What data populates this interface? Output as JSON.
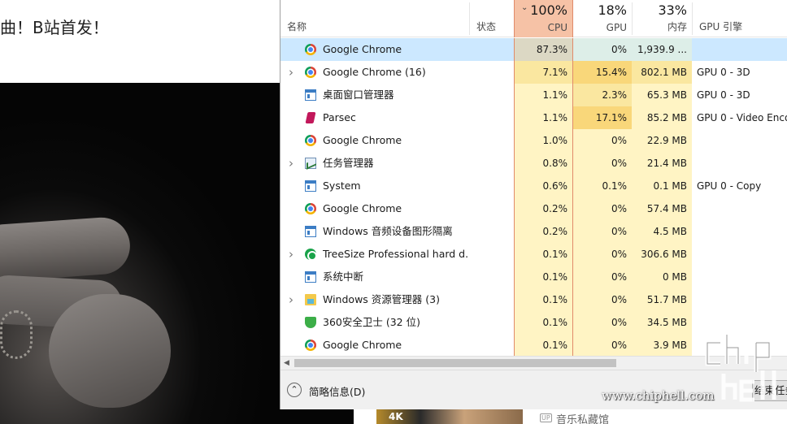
{
  "background_page": {
    "title": "曲！B站首发！",
    "thumb_badge": "4K",
    "up_badge": "UP",
    "up_name": "音乐私藏馆"
  },
  "task_manager": {
    "columns": {
      "name": "名称",
      "status": "状态",
      "cpu": {
        "pct": "100%",
        "label": "CPU"
      },
      "gpu": {
        "pct": "18%",
        "label": "GPU"
      },
      "memory": {
        "pct": "33%",
        "label": "内存"
      },
      "gpu_engine": "GPU 引擎"
    },
    "rows": [
      {
        "name": "Google Chrome",
        "icon": "chrome-icon",
        "expandable": false,
        "cpu": "87.3%",
        "gpu": "0%",
        "mem": "1,939.9 ...",
        "engine": "",
        "selected": true
      },
      {
        "name": "Google Chrome (16)",
        "icon": "chrome-icon",
        "expandable": true,
        "cpu": "7.1%",
        "gpu": "15.4%",
        "mem": "802.1 MB",
        "engine": "GPU 0 - 3D",
        "selected": false
      },
      {
        "name": "桌面窗口管理器",
        "icon": "window-icon",
        "expandable": false,
        "cpu": "1.1%",
        "gpu": "2.3%",
        "mem": "65.3 MB",
        "engine": "GPU 0 - 3D",
        "selected": false
      },
      {
        "name": "Parsec",
        "icon": "parsec-icon",
        "expandable": false,
        "cpu": "1.1%",
        "gpu": "17.1%",
        "mem": "85.2 MB",
        "engine": "GPU 0 - Video Enco",
        "selected": false
      },
      {
        "name": "Google Chrome",
        "icon": "chrome-icon",
        "expandable": false,
        "cpu": "1.0%",
        "gpu": "0%",
        "mem": "22.9 MB",
        "engine": "",
        "selected": false
      },
      {
        "name": "任务管理器",
        "icon": "task-manager-icon",
        "expandable": true,
        "cpu": "0.8%",
        "gpu": "0%",
        "mem": "21.4 MB",
        "engine": "",
        "selected": false
      },
      {
        "name": "System",
        "icon": "window-icon",
        "expandable": false,
        "cpu": "0.6%",
        "gpu": "0.1%",
        "mem": "0.1 MB",
        "engine": "GPU 0 - Copy",
        "selected": false
      },
      {
        "name": "Google Chrome",
        "icon": "chrome-icon",
        "expandable": false,
        "cpu": "0.2%",
        "gpu": "0%",
        "mem": "57.4 MB",
        "engine": "",
        "selected": false
      },
      {
        "name": "Windows 音频设备图形隔离",
        "icon": "window-icon",
        "expandable": false,
        "cpu": "0.2%",
        "gpu": "0%",
        "mem": "4.5 MB",
        "engine": "",
        "selected": false
      },
      {
        "name": "TreeSize Professional hard d...",
        "icon": "treesize-icon",
        "expandable": true,
        "cpu": "0.1%",
        "gpu": "0%",
        "mem": "306.6 MB",
        "engine": "",
        "selected": false
      },
      {
        "name": "系统中断",
        "icon": "window-icon",
        "expandable": false,
        "cpu": "0.1%",
        "gpu": "0%",
        "mem": "0 MB",
        "engine": "",
        "selected": false
      },
      {
        "name": "Windows 资源管理器 (3)",
        "icon": "folder-icon",
        "expandable": true,
        "cpu": "0.1%",
        "gpu": "0%",
        "mem": "51.7 MB",
        "engine": "",
        "selected": false
      },
      {
        "name": "360安全卫士 (32 位)",
        "icon": "shield-icon",
        "expandable": false,
        "cpu": "0.1%",
        "gpu": "0%",
        "mem": "34.5 MB",
        "engine": "",
        "selected": false
      },
      {
        "name": "Google Chrome",
        "icon": "chrome-icon",
        "expandable": false,
        "cpu": "0.1%",
        "gpu": "0%",
        "mem": "3.9 MB",
        "engine": "",
        "selected": false
      }
    ],
    "footer": {
      "fewer_details": "简略信息(D)",
      "end_task": "结束任务"
    }
  },
  "watermark": {
    "text": "www.chiphell.com",
    "logo_text": "chip hell"
  },
  "colors": {
    "selected_row": "#cce8ff",
    "cpu_header": "#f6c2a6",
    "heat_low": "#fff4c4",
    "heat_mid": "#fae7a0",
    "heat_high": "#f9d77a"
  }
}
